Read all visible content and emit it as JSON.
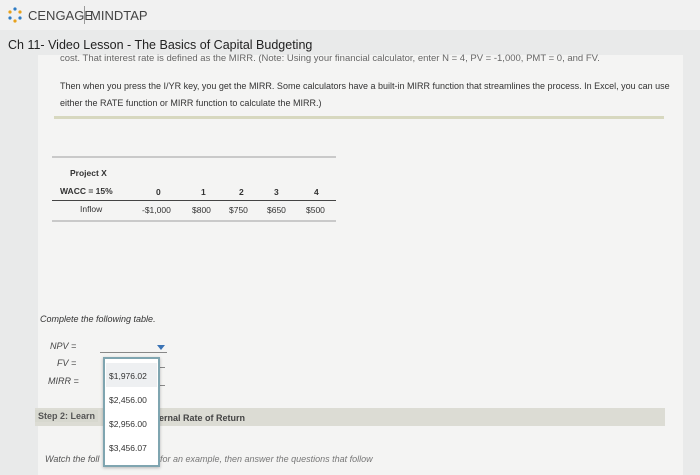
{
  "header": {
    "brand_left": "CENGAGE",
    "brand_right": "MINDTAP",
    "lesson_title": "Ch 11- Video Lesson - The Basics of Capital Budgeting"
  },
  "content": {
    "cut_text": "cost. That interest rate is defined as the MIRR. (Note: Using your financial calculator, enter N = 4, PV = -1,000, PMT = 0, and FV.",
    "paragraph": "Then when you press the I/YR key, you get the MIRR. Some calculators have a built-in MIRR function that streamlines the process. In Excel, you can use either the RATE function or MIRR function to calculate the MIRR.)"
  },
  "project_table": {
    "title": "Project X",
    "wacc_label": "WACC = 15%",
    "years": [
      "0",
      "1",
      "2",
      "3",
      "4"
    ],
    "row_label": "Inflow",
    "values": [
      "-$1,000",
      "$800",
      "$750",
      "$650",
      "$500"
    ]
  },
  "form": {
    "instruction": "Complete the following table.",
    "npv_label": "NPV =",
    "fv_label": "FV =",
    "mirr_label": "MIRR ="
  },
  "dropdown": {
    "options": [
      "$1,976.02",
      "$2,456.00",
      "$2,956.00",
      "$3,456.07"
    ]
  },
  "step2": {
    "label": "Step 2: Learn",
    "rest": "ternal Rate of Return"
  },
  "footer": {
    "watch_label": "Watch the foll",
    "watch_rest": "for an example, then answer the questions that follow"
  }
}
